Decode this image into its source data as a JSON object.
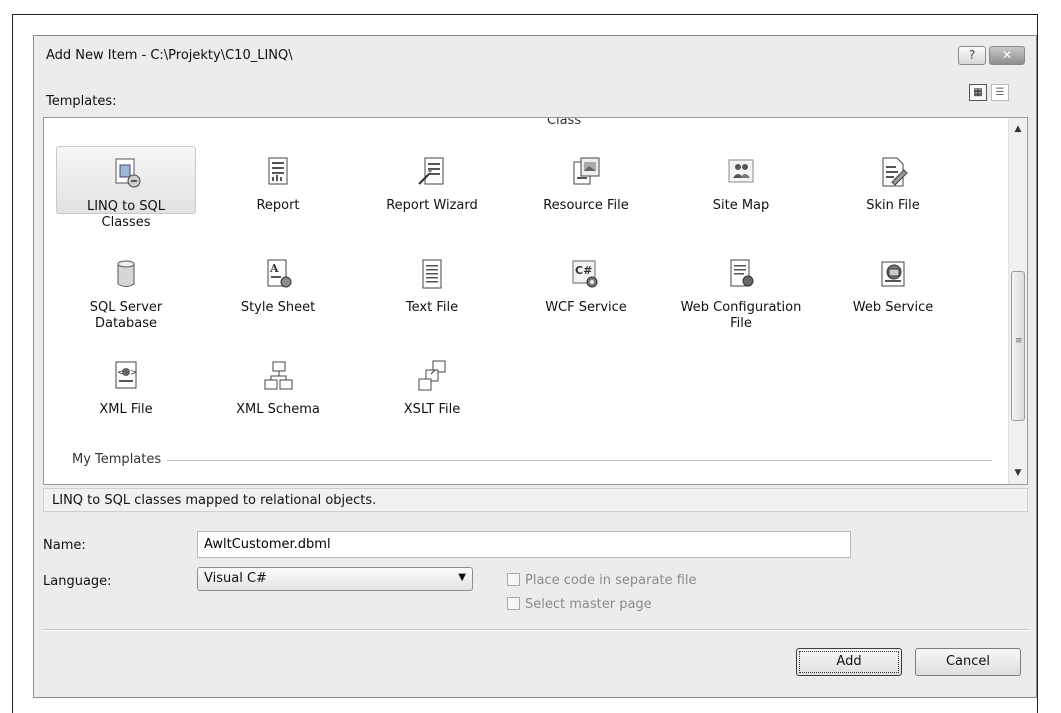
{
  "dialog": {
    "title": "Add New Item - C:\\Projekty\\C10_LINQ\\",
    "help_button": "?",
    "close_button": "✕",
    "templates_label": "Templates:",
    "view_large_icon": "▦",
    "view_small_icon": "☰"
  },
  "templates": {
    "partial_item_label": "Class",
    "items": [
      {
        "label": "LINQ to SQL Classes",
        "icon": "linq-icon",
        "selected": true
      },
      {
        "label": "Report",
        "icon": "report-icon"
      },
      {
        "label": "Report Wizard",
        "icon": "report-wizard-icon"
      },
      {
        "label": "Resource File",
        "icon": "resource-file-icon"
      },
      {
        "label": "Site Map",
        "icon": "site-map-icon"
      },
      {
        "label": "Skin File",
        "icon": "skin-file-icon"
      },
      {
        "label": "SQL Server Database",
        "icon": "database-icon"
      },
      {
        "label": "Style Sheet",
        "icon": "style-sheet-icon"
      },
      {
        "label": "Text File",
        "icon": "text-file-icon"
      },
      {
        "label": "WCF Service",
        "icon": "wcf-service-icon"
      },
      {
        "label": "Web Configuration File",
        "icon": "web-config-icon"
      },
      {
        "label": "Web Service",
        "icon": "web-service-icon"
      },
      {
        "label": "XML File",
        "icon": "xml-file-icon"
      },
      {
        "label": "XML Schema",
        "icon": "xml-schema-icon"
      },
      {
        "label": "XSLT File",
        "icon": "xslt-file-icon"
      }
    ],
    "section_label": "My Templates",
    "scroll_up": "▲",
    "scroll_down": "▼",
    "scroll_grip": "≡"
  },
  "description": "LINQ to SQL classes mapped to relational objects.",
  "form": {
    "name_label": "Name:",
    "name_value": "AwltCustomer.dbml",
    "language_label": "Language:",
    "language_value": "Visual C#",
    "language_arrow": "▼",
    "option_separate_file": "Place code in separate file",
    "option_master_page": "Select master page"
  },
  "buttons": {
    "add": "Add",
    "cancel": "Cancel"
  }
}
